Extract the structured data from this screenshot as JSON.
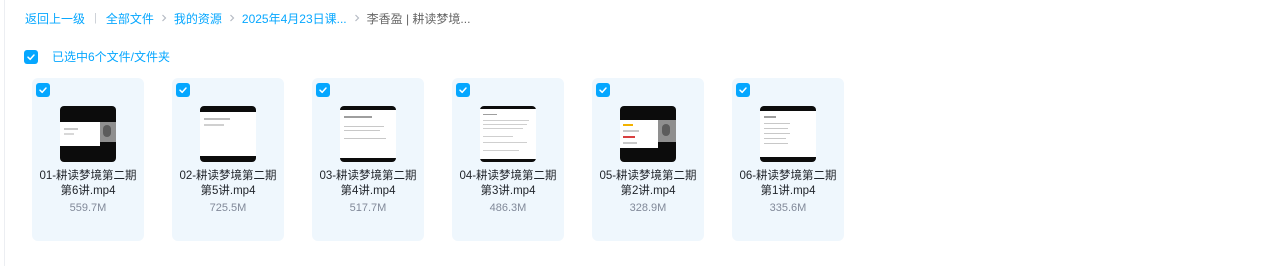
{
  "breadcrumb": {
    "back": "返回上一级",
    "all_files": "全部文件",
    "my_resources": "我的资源",
    "course_folder": "2025年4月23日课...",
    "current_folder": "李香盈 | 耕读梦境..."
  },
  "selection": {
    "label": "已选中6个文件/文件夹",
    "checked": true
  },
  "files": [
    {
      "name": "01-耕读梦境第二期第6讲.mp4",
      "size": "559.7M",
      "checked": true
    },
    {
      "name": "02-耕读梦境第二期第5讲.mp4",
      "size": "725.5M",
      "checked": true
    },
    {
      "name": "03-耕读梦境第二期第4讲.mp4",
      "size": "517.7M",
      "checked": true
    },
    {
      "name": "04-耕读梦境第二期第3讲.mp4",
      "size": "486.3M",
      "checked": true
    },
    {
      "name": "05-耕读梦境第二期第2讲.mp4",
      "size": "328.9M",
      "checked": true
    },
    {
      "name": "06-耕读梦境第二期第1讲.mp4",
      "size": "335.6M",
      "checked": true
    }
  ],
  "colors": {
    "accent": "#06a7ff",
    "card_bg": "#eff7fd",
    "size_text": "#818999"
  },
  "icons": {
    "checkbox": "checkmark-icon",
    "separator": "chevron-right-icon",
    "thumbnail": "video-thumbnail"
  }
}
